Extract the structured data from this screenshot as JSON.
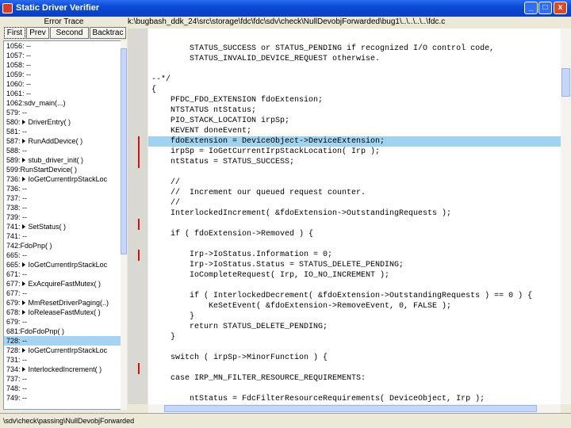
{
  "window": {
    "title": "Static Driver Verifier",
    "min": "_",
    "max": "□",
    "close": "x"
  },
  "left_panel": {
    "header": "Error Trace",
    "buttons": {
      "first": "First",
      "prev": "Prev",
      "second": "Second",
      "backtrack": "Backtrac"
    },
    "trace": [
      {
        "text": "1056: --",
        "arrow": false
      },
      {
        "text": "1057: --",
        "arrow": false
      },
      {
        "text": "1058: --",
        "arrow": false
      },
      {
        "text": "1059: --",
        "arrow": false
      },
      {
        "text": "1060: --",
        "arrow": false
      },
      {
        "text": "1061: --",
        "arrow": false
      },
      {
        "text": "1062:sdv_main(...)",
        "arrow": false
      },
      {
        "text": "579: --",
        "arrow": false
      },
      {
        "text": "580:",
        "arrow": true,
        "label": "DriverEntry( )"
      },
      {
        "text": "581: --",
        "arrow": false
      },
      {
        "text": "587:",
        "arrow": true,
        "label": "RunAddDevice( )"
      },
      {
        "text": "588: --",
        "arrow": false
      },
      {
        "text": "589:",
        "arrow": true,
        "label": "stub_driver_init( )"
      },
      {
        "text": "599:RunStartDevice( )",
        "arrow": false
      },
      {
        "text": "736:",
        "arrow": true,
        "label": "IoGetCurrentIrpStackLoc"
      },
      {
        "text": "736: --",
        "arrow": false
      },
      {
        "text": "737: --",
        "arrow": false
      },
      {
        "text": "738: --",
        "arrow": false
      },
      {
        "text": "739: --",
        "arrow": false
      },
      {
        "text": "741:",
        "arrow": true,
        "label": "SetStatus( )"
      },
      {
        "text": "741: --",
        "arrow": false
      },
      {
        "text": "742:FdoPnp( )",
        "arrow": false
      },
      {
        "text": "665: --",
        "arrow": false
      },
      {
        "text": "665:",
        "arrow": true,
        "label": "IoGetCurrentIrpStackLoc"
      },
      {
        "text": "671: --",
        "arrow": false
      },
      {
        "text": "677:",
        "arrow": true,
        "label": "ExAcquireFastMutex( )"
      },
      {
        "text": "677: --",
        "arrow": false
      },
      {
        "text": "679:",
        "arrow": true,
        "label": "MmResetDriverPaging(..)"
      },
      {
        "text": "678:",
        "arrow": true,
        "label": "IoReleaseFastMutex( )"
      },
      {
        "text": "679: --",
        "arrow": false
      },
      {
        "text": "681:FdoFdoPnp( )",
        "arrow": false
      },
      {
        "text": "728: --",
        "arrow": false,
        "selected": true
      },
      {
        "text": "728:",
        "arrow": true,
        "label": "IoGetCurrentIrpStackLoc"
      },
      {
        "text": "731: --",
        "arrow": false
      },
      {
        "text": "734:",
        "arrow": true,
        "label": "InterlockedIncrement( )"
      },
      {
        "text": "737: --",
        "arrow": false
      },
      {
        "text": "748: --",
        "arrow": false
      },
      {
        "text": "749: --",
        "arrow": false
      }
    ]
  },
  "path": "k:\\bugbash_ddk_24\\src\\storage\\fdc\\fdc\\sdv\\check\\NullDevobjForwarded\\bug1\\..\\..\\..\\..\\fdc.c",
  "code_lines": [
    {
      "text": "",
      "hl": false
    },
    {
      "text": "        STATUS_SUCCESS or STATUS_PENDING if recognized I/O control code,",
      "hl": false
    },
    {
      "text": "        STATUS_INVALID_DEVICE_REQUEST otherwise.",
      "hl": false
    },
    {
      "text": "",
      "hl": false
    },
    {
      "text": "--*/",
      "hl": false
    },
    {
      "text": "{",
      "hl": false
    },
    {
      "text": "    PFDC_FDO_EXTENSION fdoExtension;",
      "hl": false
    },
    {
      "text": "    NTSTATUS ntStatus;",
      "hl": false
    },
    {
      "text": "    PIO_STACK_LOCATION irpSp;",
      "hl": false
    },
    {
      "text": "    KEVENT doneEvent;",
      "hl": false
    },
    {
      "text": "    fdoExtension = DeviceObject->DeviceExtension;",
      "hl": true
    },
    {
      "text": "    irpSp = IoGetCurrentIrpStackLocation( Irp );",
      "hl": false
    },
    {
      "text": "    ntStatus = STATUS_SUCCESS;",
      "hl": false
    },
    {
      "text": "",
      "hl": false
    },
    {
      "text": "    //",
      "hl": false
    },
    {
      "text": "    //  Increment our queued request counter.",
      "hl": false
    },
    {
      "text": "    //",
      "hl": false
    },
    {
      "text": "    InterlockedIncrement( &fdoExtension->OutstandingRequests );",
      "hl": false
    },
    {
      "text": "",
      "hl": false
    },
    {
      "text": "    if ( fdoExtension->Removed ) {",
      "hl": false
    },
    {
      "text": "",
      "hl": false
    },
    {
      "text": "        Irp->IoStatus.Information = 0;",
      "hl": false
    },
    {
      "text": "        Irp->IoStatus.Status = STATUS_DELETE_PENDING;",
      "hl": false
    },
    {
      "text": "        IoCompleteRequest( Irp, IO_NO_INCREMENT );",
      "hl": false
    },
    {
      "text": "",
      "hl": false
    },
    {
      "text": "        if ( InterlockedDecrement( &fdoExtension->OutstandingRequests ) == 0 ) {",
      "hl": false
    },
    {
      "text": "            KeSetEvent( &fdoExtension->RemoveEvent, 0, FALSE );",
      "hl": false
    },
    {
      "text": "        }",
      "hl": false
    },
    {
      "text": "        return STATUS_DELETE_PENDING;",
      "hl": false
    },
    {
      "text": "    }",
      "hl": false
    },
    {
      "text": "",
      "hl": false
    },
    {
      "text": "    switch ( irpSp->MinorFunction ) {",
      "hl": false
    },
    {
      "text": "",
      "hl": false
    },
    {
      "text": "    case IRP_MN_FILTER_RESOURCE_REQUIREMENTS:",
      "hl": false
    },
    {
      "text": "",
      "hl": false
    },
    {
      "text": "        ntStatus = FdcFilterResourceRequirements( DeviceObject, Irp );",
      "hl": false
    }
  ],
  "statusbar": "\\sdv\\check\\passing\\NullDevobjForwarded",
  "colors": {
    "highlight": "#9fd3ef",
    "gutter_mark": "#cc1111",
    "titlebar": "#0a4bd6"
  }
}
